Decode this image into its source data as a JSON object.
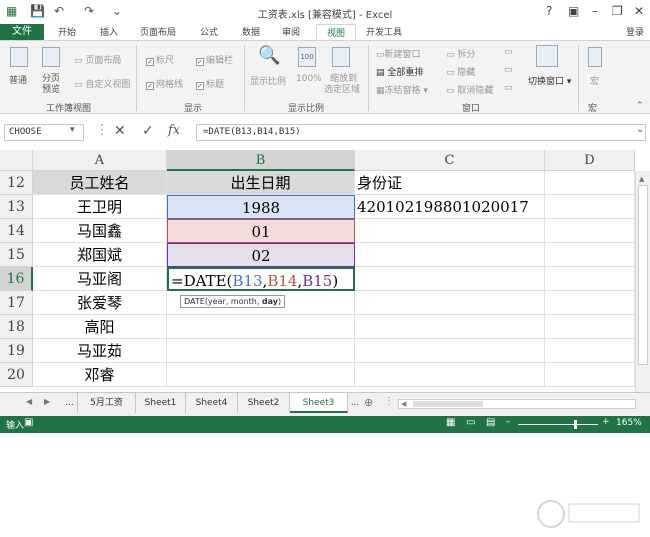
{
  "window": {
    "title": "工资表.xls [兼容模式] - Excel",
    "help": "?",
    "login": "登录"
  },
  "tabs": {
    "file": "文件",
    "items": [
      "开始",
      "插入",
      "页面布局",
      "公式",
      "数据",
      "审阅",
      "视图",
      "开发工具"
    ]
  },
  "ribbon": {
    "normal": "普通",
    "page_break_1": "分页",
    "page_break_2": "预览",
    "page_layout": "页面布局",
    "custom_view": "自定义视图",
    "group_views": "工作簿视图",
    "ruler": "标尺",
    "formula_bar": "编辑栏",
    "gridlines": "网格线",
    "headings": "标题",
    "group_show": "显示",
    "zoom": "显示比例",
    "zoom100": "100%",
    "zoom_sel_1": "缩放到",
    "zoom_sel_2": "选定区域",
    "group_zoom": "显示比例",
    "new_window": "新建窗口",
    "arrange_all": "全部重排",
    "freeze": "冻结窗格",
    "split": "拆分",
    "hide": "隐藏",
    "unhide": "取消隐藏",
    "switch_window": "切换窗口",
    "group_window": "窗口",
    "macro": "宏",
    "group_macro": "宏"
  },
  "formula_bar": {
    "name_box": "CHOOSE",
    "fx": "fx",
    "formula": "=DATE(B13,B14,B15)"
  },
  "columns": [
    "A",
    "B",
    "C",
    "D"
  ],
  "rows": [
    {
      "num": "12",
      "a": "员工姓名",
      "b": "出生日期",
      "c": "身份证"
    },
    {
      "num": "13",
      "a": "王卫明",
      "b": "1988",
      "c": "420102198801020017"
    },
    {
      "num": "14",
      "a": "马国鑫",
      "b": "01",
      "c": ""
    },
    {
      "num": "15",
      "a": "郑国斌",
      "b": "02",
      "c": ""
    },
    {
      "num": "16",
      "a": "马亚阁",
      "b": "",
      "c": ""
    },
    {
      "num": "17",
      "a": "张爱琴",
      "b": "",
      "c": ""
    },
    {
      "num": "18",
      "a": "高阳",
      "b": "",
      "c": ""
    },
    {
      "num": "19",
      "a": "马亚茹",
      "b": "",
      "c": ""
    },
    {
      "num": "20",
      "a": "邓睿",
      "b": "",
      "c": ""
    }
  ],
  "edit_cell": {
    "prefix": "=DATE(",
    "ref1": "B13",
    "comma1": ",",
    "ref2": "B14",
    "comma2": ",",
    "ref3": "B15",
    "suffix": ")"
  },
  "tooltip": {
    "fn": "DATE(year, month, ",
    "bold_arg": "day",
    "close": ")"
  },
  "sheets": [
    "5月工资",
    "Sheet1",
    "Sheet4",
    "Sheet2",
    "Sheet3"
  ],
  "sheet_more": "...",
  "status": {
    "mode": "输入",
    "zoom": "165%"
  },
  "colors": {
    "excel_green": "#217346",
    "ref_blue": "#4472c4",
    "ref_red": "#c0504d",
    "ref_purple": "#7030a0"
  }
}
